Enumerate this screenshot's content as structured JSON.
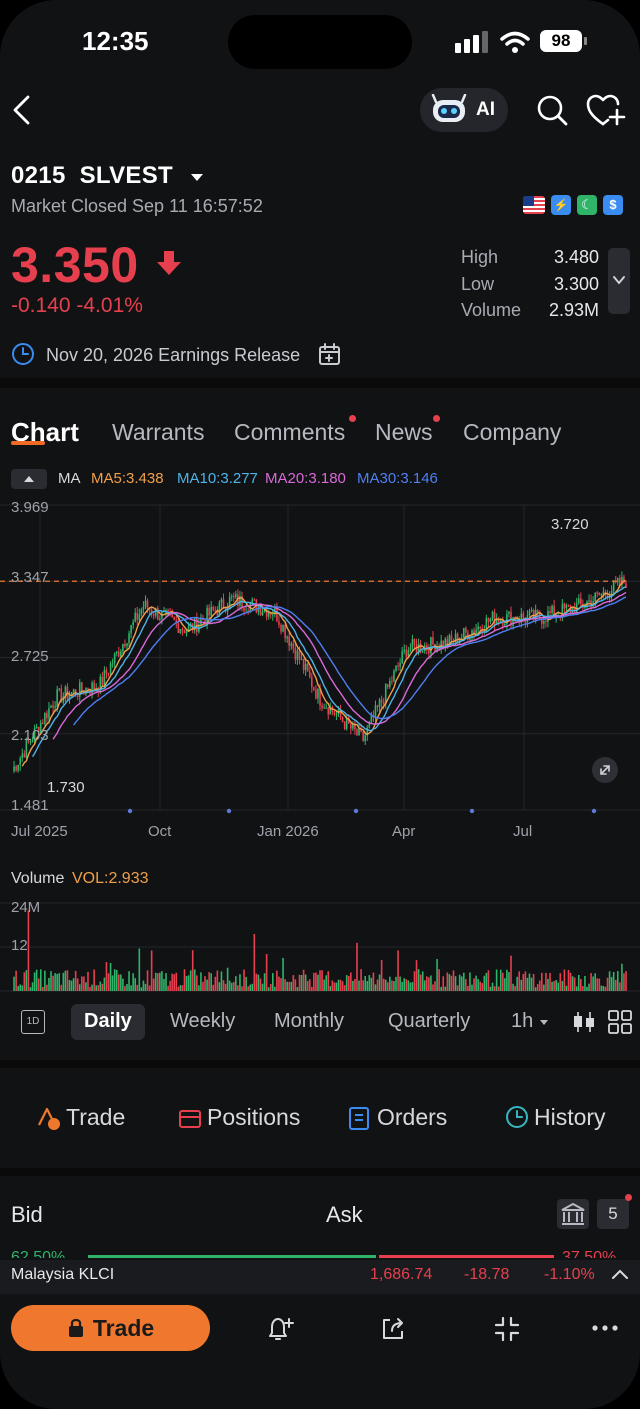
{
  "status": {
    "time": "12:35",
    "battery": "98"
  },
  "header": {
    "ai_label": "AI"
  },
  "stock": {
    "code": "0215",
    "name": "SLVEST",
    "market_status": "Market Closed Sep 11 16:57:52",
    "price": "3.350",
    "change": "-0.140 -4.01%",
    "stats": [
      {
        "label": "High",
        "value": "3.480"
      },
      {
        "label": "Low",
        "value": "3.300"
      },
      {
        "label": "Volume",
        "value": "2.93M"
      }
    ],
    "earnings": "Nov 20, 2026 Earnings Release"
  },
  "tabs": [
    "Chart",
    "Warrants",
    "Comments",
    "News",
    "Company"
  ],
  "ma": {
    "label": "MA",
    "items": [
      {
        "text": "MA5:3.438",
        "color": "#f0a04b"
      },
      {
        "text": "MA10:3.277",
        "color": "#4fb3e8"
      },
      {
        "text": "MA20:3.180",
        "color": "#d86ad8"
      },
      {
        "text": "MA30:3.146",
        "color": "#4f7ff0"
      }
    ]
  },
  "chart_data": [
    {
      "type": "line",
      "title": "",
      "y_ticks": [
        "3.969",
        "3.347",
        "2.725",
        "2.103",
        "1.481"
      ],
      "x_ticks": [
        "Jul 2025",
        "Oct",
        "Jan 2026",
        "Apr",
        "Jul"
      ],
      "ylim": [
        1.481,
        3.969
      ],
      "annotations": {
        "high": "3.720",
        "low": "1.730"
      },
      "reference_line": 3.347,
      "x": [
        "2025-07",
        "2025-08",
        "2025-09",
        "2025-10",
        "2025-11",
        "2025-12",
        "2026-01",
        "2026-02",
        "2026-03",
        "2026-04",
        "2026-05",
        "2026-06",
        "2026-07",
        "2026-08",
        "2026-09"
      ],
      "series": [
        {
          "values": [
            1.8,
            2.4,
            2.5,
            3.15,
            2.95,
            3.2,
            3.1,
            2.4,
            2.05,
            2.8,
            2.85,
            3.05,
            3.05,
            3.15,
            3.35
          ]
        }
      ]
    },
    {
      "type": "bar",
      "title": "Volume",
      "label": "VOL:2.933",
      "y_ticks": [
        "24M",
        "12"
      ],
      "ylim": [
        0,
        24
      ]
    }
  ],
  "periods": {
    "items": [
      "Daily",
      "Weekly",
      "Monthly",
      "Quarterly"
    ],
    "active": "Daily",
    "interval": "1h",
    "oned": "1D"
  },
  "trade_tabs": [
    "Trade",
    "Positions",
    "Orders",
    "History"
  ],
  "bidask": {
    "bid": "Bid",
    "ask": "Ask",
    "levels": "5",
    "bid_pct": "62.50%",
    "ask_pct": "37.50%"
  },
  "index": {
    "name": "Malaysia KLCI",
    "value": "1,686.74",
    "change": "-18.78",
    "pct": "-1.10%"
  },
  "bottom": {
    "trade_label": "Trade"
  },
  "colors": {
    "up": "#2fb46a",
    "down": "#e6404f",
    "accent": "#f26b24"
  }
}
